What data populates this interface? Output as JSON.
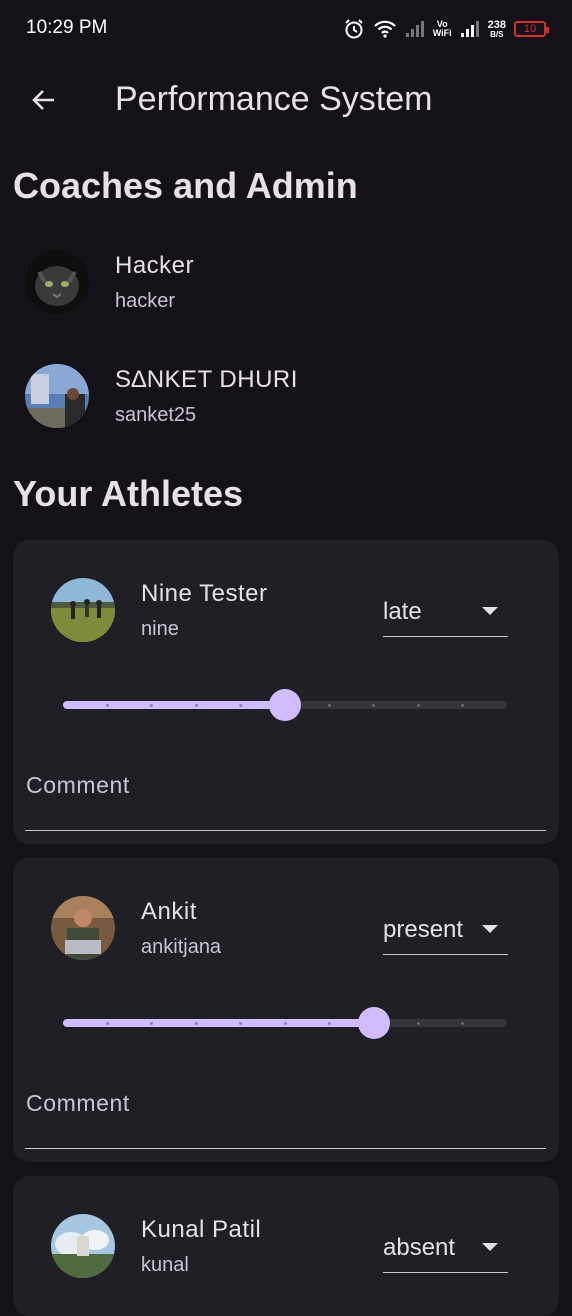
{
  "status_bar": {
    "time": "10:29 PM",
    "vowifi_top": "Vo",
    "vowifi_bottom": "WiFi",
    "speed_value": "238",
    "speed_unit": "B/S",
    "battery": "10",
    "battery_color": "#d32f2f"
  },
  "app_bar": {
    "title": "Performance System"
  },
  "coaches_section": {
    "title": "Coaches and Admin",
    "people": [
      {
        "name": "Hacker",
        "username": "hacker"
      },
      {
        "name": "S∆NKET DHURI",
        "username": "sanket25"
      }
    ]
  },
  "athletes_section": {
    "title": "Your Athletes",
    "athletes": [
      {
        "name": "Nine Tester",
        "username": "nine",
        "status": "late",
        "rating_fraction": 0.5,
        "comment_label": "Comment"
      },
      {
        "name": "Ankit",
        "username": "ankitjana",
        "status": "present",
        "rating_fraction": 0.7,
        "comment_label": "Comment"
      },
      {
        "name": "Kunal Patil",
        "username": "kunal",
        "status": "absent"
      }
    ]
  },
  "theme": {
    "background": "#141218",
    "card": "#211f26",
    "accent": "#d0bcff",
    "track": "#36343b"
  }
}
